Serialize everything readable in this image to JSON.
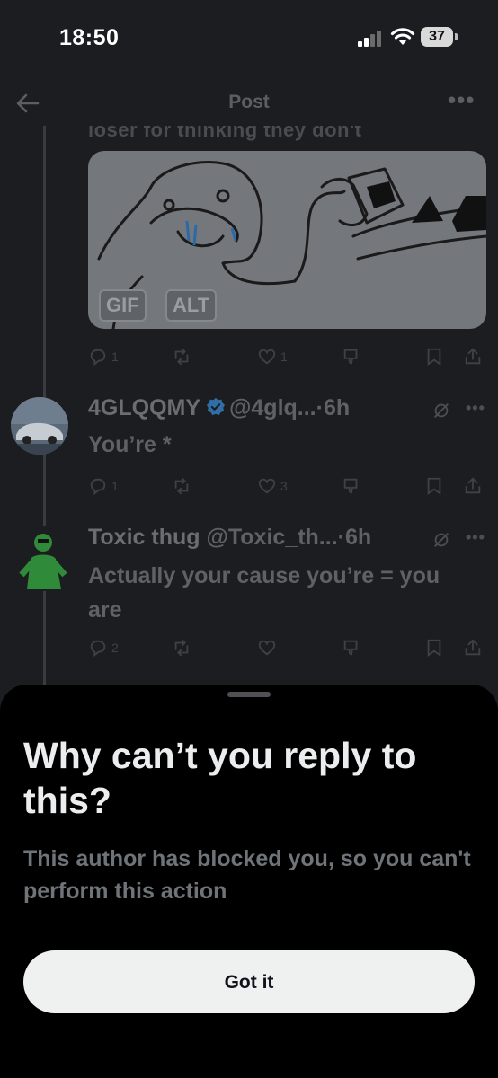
{
  "status_bar": {
    "time": "18:50",
    "battery": "37"
  },
  "header": {
    "title": "Post",
    "more": "•••"
  },
  "thread": {
    "cut_text": "loser for thinking they don't",
    "media_badges": {
      "gif": "GIF",
      "alt": "ALT"
    },
    "actions": {
      "replies": "1",
      "likes": "1"
    }
  },
  "replies": [
    {
      "name": "4GLQQMY",
      "handle": "@4glq...",
      "time": "6h",
      "separator": "·",
      "text": "You’re *",
      "reply_count": "1",
      "like_count": "3"
    },
    {
      "name": "Toxic thug",
      "handle": "@Toxic_th...",
      "time": "6h",
      "separator": "·",
      "text": "Actually your cause you’re = you are",
      "reply_count": "2",
      "like_count": ""
    }
  ],
  "sheet": {
    "title": "Why can’t you reply to this?",
    "body": "This author has blocked you, so you can't perform this action",
    "button": "Got it"
  },
  "colors": {
    "sheet_bg": "#000000",
    "button_bg": "#eff1f1",
    "verified": "#1d9bf0"
  }
}
